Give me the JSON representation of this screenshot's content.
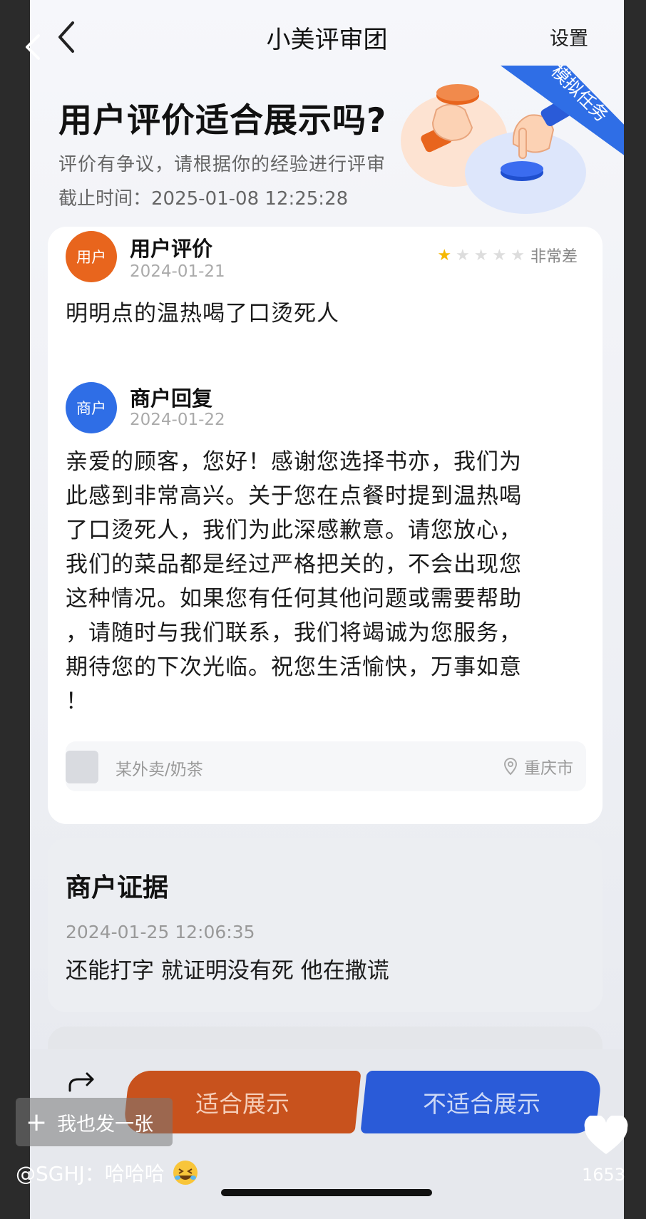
{
  "header": {
    "title": "小美评审团",
    "settings_label": "设置"
  },
  "hero": {
    "title": "用户评价适合展示吗?",
    "subtitle": "评价有争议，请根据你的经验进行评审",
    "deadline_label": "截止时间：",
    "deadline_value": "2025-01-08 12:25:28",
    "ribbon_text": "模拟任务"
  },
  "review": {
    "user": {
      "avatar_text": "用户",
      "label": "用户评价",
      "date": "2024-01-21",
      "rating_stars": 1,
      "rating_max": 5,
      "rating_label": "非常差",
      "comment": "明明点的温热喝了口烫死人"
    },
    "merchant": {
      "avatar_text": "商户",
      "label": "商户回复",
      "date": "2024-01-22",
      "reply_lines": [
        "亲爱的顾客，您好！感谢您选择书亦，我们为",
        "此感到非常高兴。关于您在点餐时提到温热喝",
        "了口烫死人，我们为此深感歉意。请您放心，",
        "我们的菜品都是经过严格把关的，不会出现您",
        "这种情况。如果您有任何其他问题或需要帮助",
        "，请随时与我们联系，我们将竭诚为您服务，",
        "期待您的下次光临。祝您生活愉快，万事如意",
        "！"
      ]
    },
    "store": {
      "name": "某外卖/奶茶",
      "city": "重庆市"
    }
  },
  "evidence": {
    "title": "商户证据",
    "time": "2024-01-25 12:06:35",
    "text": "还能打字 就证明没有死 他在撒谎"
  },
  "actions": {
    "suitable_label": "适合展示",
    "unsuitable_label": "不适合展示"
  },
  "overlay": {
    "share_label": "我也发一张",
    "comment": "@SGHJ：哈哈哈",
    "likes": "1653"
  },
  "colors": {
    "accent_orange": "#c8521d",
    "accent_blue": "#2a5bd8",
    "user_avatar": "#e8651d",
    "merchant_avatar": "#2f6ee6",
    "star_active": "#f5b800"
  }
}
